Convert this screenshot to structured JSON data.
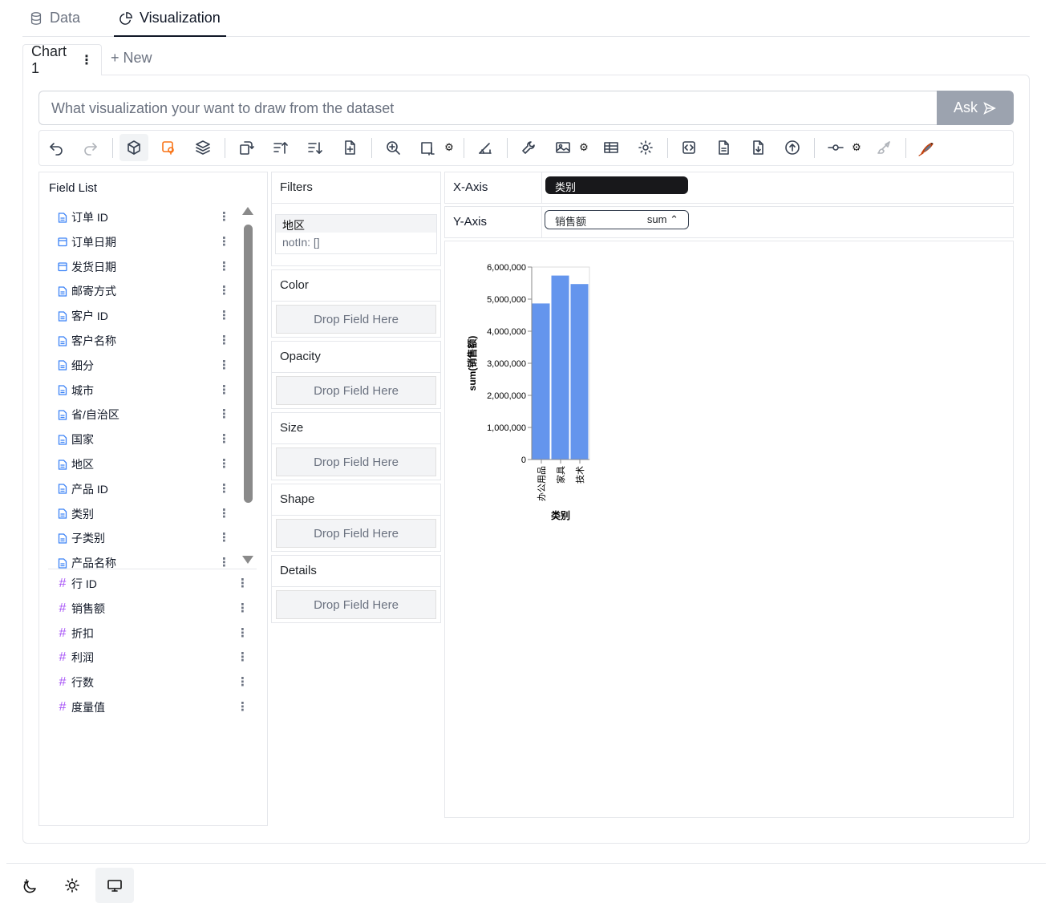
{
  "top_tabs": {
    "data_label": "Data",
    "visualization_label": "Visualization"
  },
  "chart_tabs": {
    "chart_label": "Chart 1",
    "new_label": "+ New"
  },
  "ask": {
    "placeholder": "What visualization your want to draw from the dataset",
    "button_label": "Ask"
  },
  "toolbar": {
    "icons": [
      "undo-icon",
      "redo-icon",
      "cube-icon",
      "lasso-icon",
      "layers-icon",
      "transpose-icon",
      "sort-ascending-icon",
      "sort-descending-icon",
      "add-file-icon",
      "zoom-icon",
      "resize-icon",
      "gear-icon",
      "axes-icon",
      "wrench-icon",
      "image-icon",
      "gear-icon",
      "table-icon",
      "settings-icon",
      "code-icon",
      "file-icon",
      "download-icon",
      "upload-icon",
      "commit-icon",
      "gear-icon",
      "brush-icon",
      "bird-logo-icon"
    ]
  },
  "field_list": {
    "title": "Field List",
    "dimensions": [
      "订单 ID",
      "订单日期",
      "发货日期",
      "邮寄方式",
      "客户 ID",
      "客户名称",
      "细分",
      "城市",
      "省/自治区",
      "国家",
      "地区",
      "产品 ID",
      "类别",
      "子类别",
      "产品名称"
    ],
    "measures": [
      "行 ID",
      "销售额",
      "折扣",
      "利润",
      "行数",
      "度量值"
    ]
  },
  "filters": {
    "title": "Filters",
    "field": "地区",
    "value": "notIn: []"
  },
  "encodings": {
    "color": "Color",
    "opacity": "Opacity",
    "size": "Size",
    "shape": "Shape",
    "details": "Details",
    "drop_label": "Drop Field Here"
  },
  "axes": {
    "x_label": "X-Axis",
    "x_field": "类别",
    "y_label": "Y-Axis",
    "y_field": "销售额",
    "y_agg": "sum"
  },
  "chart_data": {
    "type": "bar",
    "categories": [
      "办公用品",
      "家具",
      "技术"
    ],
    "values": [
      4865000,
      5735000,
      5470000
    ],
    "xlabel": "类别",
    "ylabel": "sum(销售额)",
    "ylim": [
      0,
      6000000
    ],
    "yticks": [
      "0",
      "1,000,000",
      "2,000,000",
      "3,000,000",
      "4,000,000",
      "5,000,000",
      "6,000,000"
    ],
    "grid": false,
    "color": "#6495ed"
  },
  "footer": {
    "icons": [
      "dark-mode-icon",
      "light-mode-icon",
      "system-mode-icon"
    ]
  },
  "colors": {
    "accent": "#111827",
    "bar": "#6495ed",
    "ask_button": "#9ca3af",
    "measure_hash": "#a855f7",
    "dimension_icon": "#3b82f6"
  }
}
